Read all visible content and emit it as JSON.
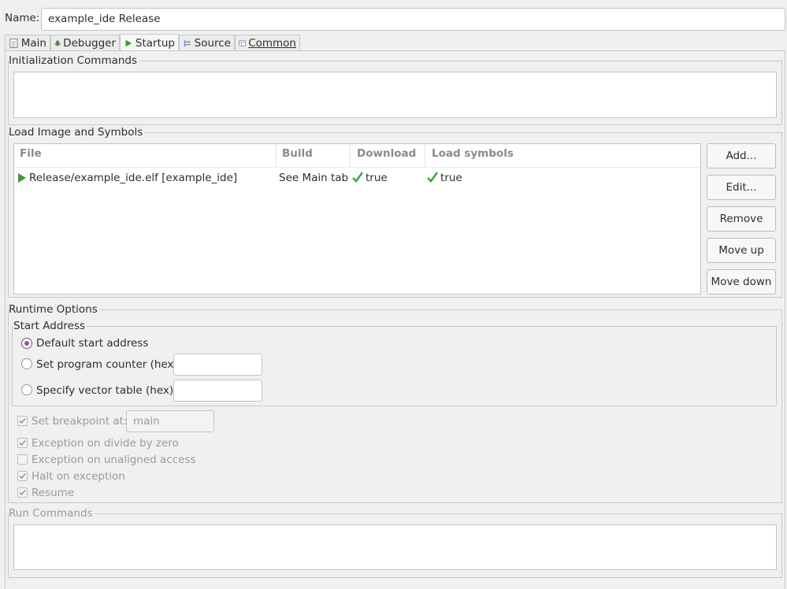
{
  "name_label": "Name:",
  "name_value": "example_ide Release",
  "tabs": [
    {
      "label": "Main",
      "icon": "document-icon"
    },
    {
      "label": "Debugger",
      "icon": "bug-icon"
    },
    {
      "label": "Startup",
      "icon": "play-icon"
    },
    {
      "label": "Source",
      "icon": "source-icon"
    },
    {
      "label": "Common",
      "icon": "table-icon"
    }
  ],
  "active_tab": "Startup",
  "init_commands": {
    "title": "Initialization Commands",
    "value": ""
  },
  "load_image": {
    "title": "Load Image and Symbols",
    "columns": [
      "File",
      "Build",
      "Download",
      "Load symbols"
    ],
    "rows": [
      {
        "file": "Release/example_ide.elf [example_ide]",
        "build": "See Main tab",
        "download": "true",
        "load_symbols": "true"
      }
    ],
    "buttons": [
      "Add...",
      "Edit...",
      "Remove",
      "Move up",
      "Move down"
    ]
  },
  "runtime": {
    "title": "Runtime Options",
    "start_address": {
      "title": "Start Address",
      "options": [
        {
          "label": "Default start address",
          "selected": true
        },
        {
          "label": "Set program counter (hex):",
          "selected": false,
          "value": ""
        },
        {
          "label": "Specify vector table (hex):",
          "selected": false,
          "value": ""
        }
      ]
    },
    "set_breakpoint": {
      "label": "Set breakpoint at:",
      "checked": true,
      "value": "main"
    },
    "exception_divide": {
      "label": "Exception on divide by zero",
      "checked": true
    },
    "exception_unaligned": {
      "label": "Exception on unaligned access",
      "checked": false
    },
    "halt_on_exception": {
      "label": "Halt on exception",
      "checked": true
    },
    "resume": {
      "label": "Resume",
      "checked": true
    }
  },
  "run_commands": {
    "title": "Run Commands",
    "value": ""
  },
  "colors": {
    "accent_radio": "#8d5a97",
    "check_green": "#3aa335",
    "play_green": "#3c9a2c"
  }
}
